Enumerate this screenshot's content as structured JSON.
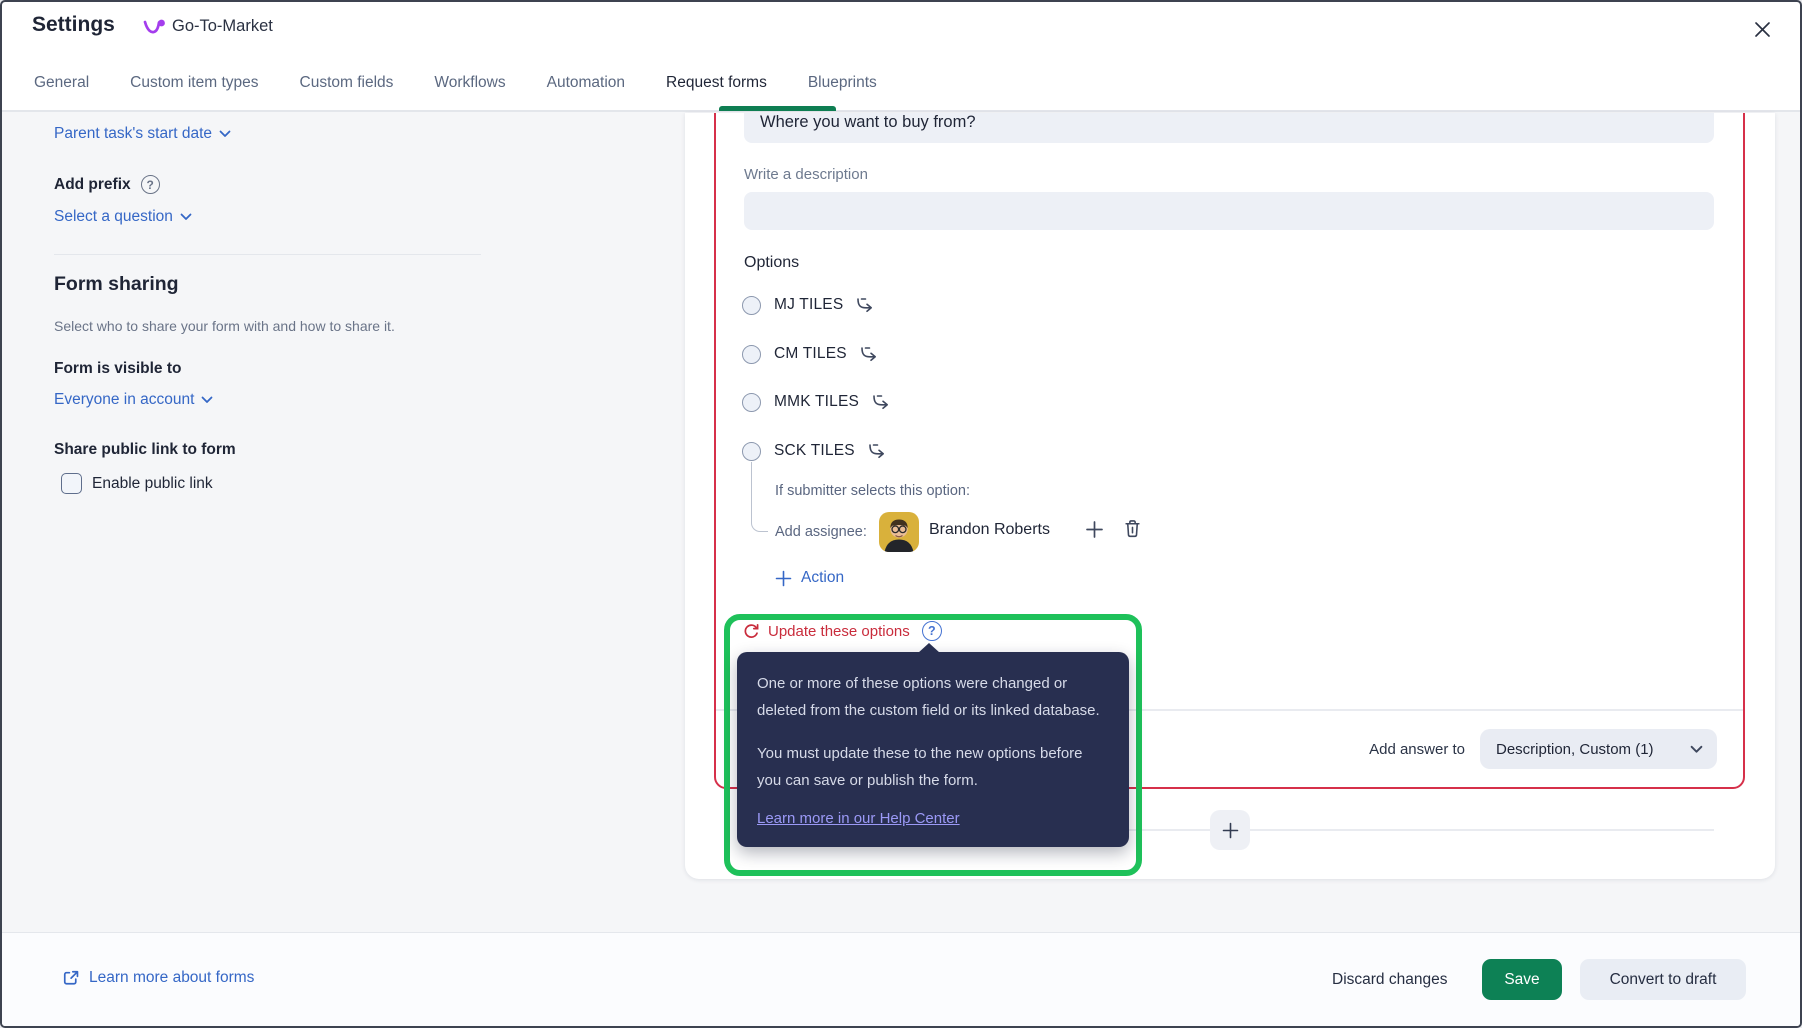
{
  "header": {
    "title": "Settings",
    "project_name": "Go-To-Market"
  },
  "tabs": [
    {
      "label": "General"
    },
    {
      "label": "Custom item types"
    },
    {
      "label": "Custom fields"
    },
    {
      "label": "Workflows"
    },
    {
      "label": "Automation"
    },
    {
      "label": "Request forms",
      "active": true
    },
    {
      "label": "Blueprints"
    }
  ],
  "sidebar": {
    "parent_task_link": "Parent task's start date",
    "add_prefix_label": "Add prefix",
    "select_question_link": "Select a question",
    "form_sharing_title": "Form sharing",
    "form_sharing_description": "Select who to share your form with and how to share it.",
    "visibility_label": "Form is visible to",
    "visibility_value": "Everyone in account",
    "public_link_label": "Share public link to form",
    "enable_public_link_label": "Enable public link"
  },
  "form": {
    "question_title": "Where you want to buy from?",
    "description_label": "Write a description",
    "description_value": "",
    "options_label": "Options",
    "options": [
      "MJ TILES",
      "CM TILES",
      "MMK TILES",
      "SCK TILES"
    ],
    "condition_label": "If submitter selects this option:",
    "assignee_label": "Add assignee:",
    "assignee_name": "Brandon Roberts",
    "action_label": "Action",
    "update_options_label": "Update these options",
    "tooltip": {
      "p1": "One or more of these options were changed or deleted from the custom field or its linked database.",
      "p2": "You must update these to the new options before you can save or publish the form.",
      "link": "Learn more in our Help Center"
    },
    "add_answer_label": "Add answer to",
    "add_answer_value": "Description, Custom (1)"
  },
  "footer": {
    "learn_more": "Learn more about forms",
    "discard": "Discard changes",
    "save": "Save",
    "convert": "Convert to draft"
  },
  "glyphs": {
    "question_mark": "?"
  },
  "colors": {
    "accent_green": "#0d8155",
    "annotation_green": "#1ec15a",
    "error_red": "#d6304a",
    "link_blue": "#3567c6",
    "tooltip_bg": "#282f50"
  }
}
